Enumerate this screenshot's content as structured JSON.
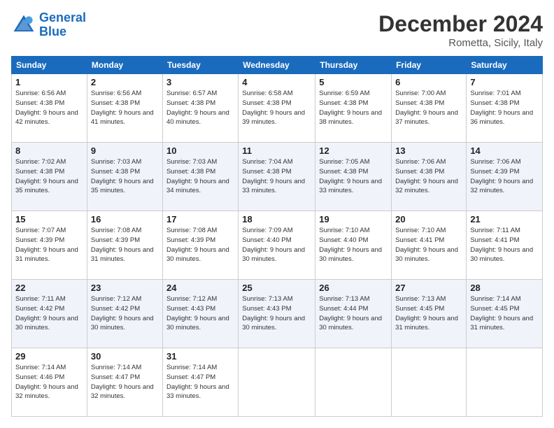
{
  "header": {
    "logo_line1": "General",
    "logo_line2": "Blue",
    "month": "December 2024",
    "location": "Rometta, Sicily, Italy"
  },
  "weekdays": [
    "Sunday",
    "Monday",
    "Tuesday",
    "Wednesday",
    "Thursday",
    "Friday",
    "Saturday"
  ],
  "weeks": [
    [
      {
        "day": "1",
        "sunrise": "Sunrise: 6:56 AM",
        "sunset": "Sunset: 4:38 PM",
        "daylight": "Daylight: 9 hours and 42 minutes."
      },
      {
        "day": "2",
        "sunrise": "Sunrise: 6:56 AM",
        "sunset": "Sunset: 4:38 PM",
        "daylight": "Daylight: 9 hours and 41 minutes."
      },
      {
        "day": "3",
        "sunrise": "Sunrise: 6:57 AM",
        "sunset": "Sunset: 4:38 PM",
        "daylight": "Daylight: 9 hours and 40 minutes."
      },
      {
        "day": "4",
        "sunrise": "Sunrise: 6:58 AM",
        "sunset": "Sunset: 4:38 PM",
        "daylight": "Daylight: 9 hours and 39 minutes."
      },
      {
        "day": "5",
        "sunrise": "Sunrise: 6:59 AM",
        "sunset": "Sunset: 4:38 PM",
        "daylight": "Daylight: 9 hours and 38 minutes."
      },
      {
        "day": "6",
        "sunrise": "Sunrise: 7:00 AM",
        "sunset": "Sunset: 4:38 PM",
        "daylight": "Daylight: 9 hours and 37 minutes."
      },
      {
        "day": "7",
        "sunrise": "Sunrise: 7:01 AM",
        "sunset": "Sunset: 4:38 PM",
        "daylight": "Daylight: 9 hours and 36 minutes."
      }
    ],
    [
      {
        "day": "8",
        "sunrise": "Sunrise: 7:02 AM",
        "sunset": "Sunset: 4:38 PM",
        "daylight": "Daylight: 9 hours and 35 minutes."
      },
      {
        "day": "9",
        "sunrise": "Sunrise: 7:03 AM",
        "sunset": "Sunset: 4:38 PM",
        "daylight": "Daylight: 9 hours and 35 minutes."
      },
      {
        "day": "10",
        "sunrise": "Sunrise: 7:03 AM",
        "sunset": "Sunset: 4:38 PM",
        "daylight": "Daylight: 9 hours and 34 minutes."
      },
      {
        "day": "11",
        "sunrise": "Sunrise: 7:04 AM",
        "sunset": "Sunset: 4:38 PM",
        "daylight": "Daylight: 9 hours and 33 minutes."
      },
      {
        "day": "12",
        "sunrise": "Sunrise: 7:05 AM",
        "sunset": "Sunset: 4:38 PM",
        "daylight": "Daylight: 9 hours and 33 minutes."
      },
      {
        "day": "13",
        "sunrise": "Sunrise: 7:06 AM",
        "sunset": "Sunset: 4:38 PM",
        "daylight": "Daylight: 9 hours and 32 minutes."
      },
      {
        "day": "14",
        "sunrise": "Sunrise: 7:06 AM",
        "sunset": "Sunset: 4:39 PM",
        "daylight": "Daylight: 9 hours and 32 minutes."
      }
    ],
    [
      {
        "day": "15",
        "sunrise": "Sunrise: 7:07 AM",
        "sunset": "Sunset: 4:39 PM",
        "daylight": "Daylight: 9 hours and 31 minutes."
      },
      {
        "day": "16",
        "sunrise": "Sunrise: 7:08 AM",
        "sunset": "Sunset: 4:39 PM",
        "daylight": "Daylight: 9 hours and 31 minutes."
      },
      {
        "day": "17",
        "sunrise": "Sunrise: 7:08 AM",
        "sunset": "Sunset: 4:39 PM",
        "daylight": "Daylight: 9 hours and 30 minutes."
      },
      {
        "day": "18",
        "sunrise": "Sunrise: 7:09 AM",
        "sunset": "Sunset: 4:40 PM",
        "daylight": "Daylight: 9 hours and 30 minutes."
      },
      {
        "day": "19",
        "sunrise": "Sunrise: 7:10 AM",
        "sunset": "Sunset: 4:40 PM",
        "daylight": "Daylight: 9 hours and 30 minutes."
      },
      {
        "day": "20",
        "sunrise": "Sunrise: 7:10 AM",
        "sunset": "Sunset: 4:41 PM",
        "daylight": "Daylight: 9 hours and 30 minutes."
      },
      {
        "day": "21",
        "sunrise": "Sunrise: 7:11 AM",
        "sunset": "Sunset: 4:41 PM",
        "daylight": "Daylight: 9 hours and 30 minutes."
      }
    ],
    [
      {
        "day": "22",
        "sunrise": "Sunrise: 7:11 AM",
        "sunset": "Sunset: 4:42 PM",
        "daylight": "Daylight: 9 hours and 30 minutes."
      },
      {
        "day": "23",
        "sunrise": "Sunrise: 7:12 AM",
        "sunset": "Sunset: 4:42 PM",
        "daylight": "Daylight: 9 hours and 30 minutes."
      },
      {
        "day": "24",
        "sunrise": "Sunrise: 7:12 AM",
        "sunset": "Sunset: 4:43 PM",
        "daylight": "Daylight: 9 hours and 30 minutes."
      },
      {
        "day": "25",
        "sunrise": "Sunrise: 7:13 AM",
        "sunset": "Sunset: 4:43 PM",
        "daylight": "Daylight: 9 hours and 30 minutes."
      },
      {
        "day": "26",
        "sunrise": "Sunrise: 7:13 AM",
        "sunset": "Sunset: 4:44 PM",
        "daylight": "Daylight: 9 hours and 30 minutes."
      },
      {
        "day": "27",
        "sunrise": "Sunrise: 7:13 AM",
        "sunset": "Sunset: 4:45 PM",
        "daylight": "Daylight: 9 hours and 31 minutes."
      },
      {
        "day": "28",
        "sunrise": "Sunrise: 7:14 AM",
        "sunset": "Sunset: 4:45 PM",
        "daylight": "Daylight: 9 hours and 31 minutes."
      }
    ],
    [
      {
        "day": "29",
        "sunrise": "Sunrise: 7:14 AM",
        "sunset": "Sunset: 4:46 PM",
        "daylight": "Daylight: 9 hours and 32 minutes."
      },
      {
        "day": "30",
        "sunrise": "Sunrise: 7:14 AM",
        "sunset": "Sunset: 4:47 PM",
        "daylight": "Daylight: 9 hours and 32 minutes."
      },
      {
        "day": "31",
        "sunrise": "Sunrise: 7:14 AM",
        "sunset": "Sunset: 4:47 PM",
        "daylight": "Daylight: 9 hours and 33 minutes."
      },
      null,
      null,
      null,
      null
    ]
  ]
}
